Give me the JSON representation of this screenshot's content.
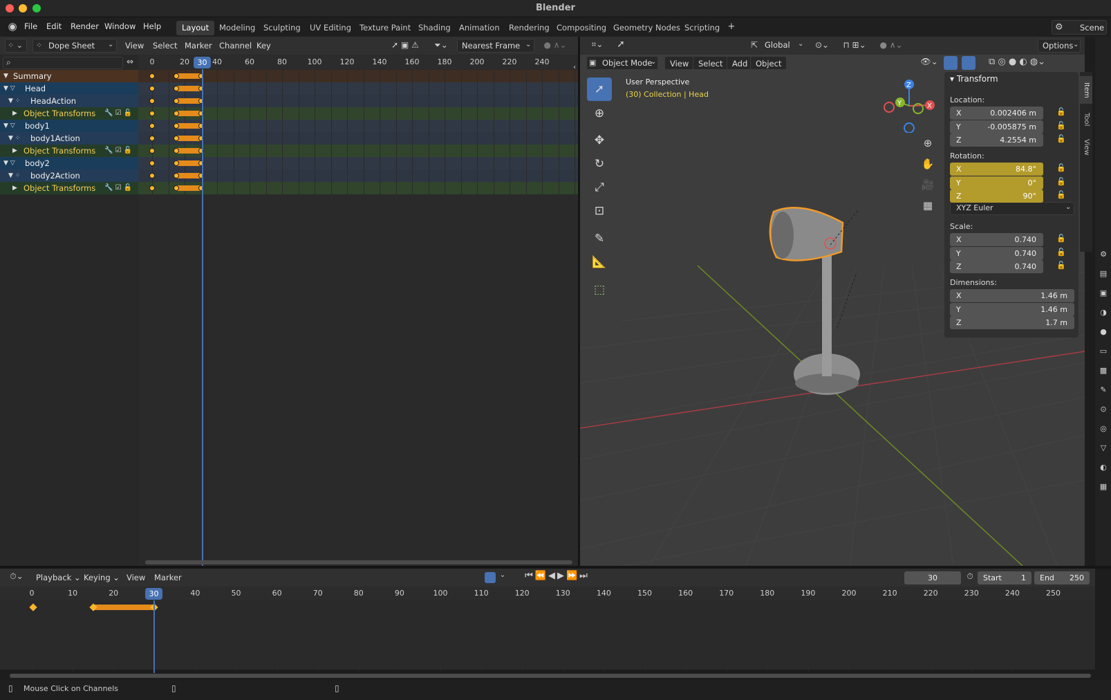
{
  "window": {
    "title": "Blender"
  },
  "menu": [
    "File",
    "Edit",
    "Render",
    "Window",
    "Help"
  ],
  "workspaces": [
    "Layout",
    "Modeling",
    "Sculpting",
    "UV Editing",
    "Texture Paint",
    "Shading",
    "Animation",
    "Rendering",
    "Compositing",
    "Geometry Nodes",
    "Scripting"
  ],
  "active_workspace": "Layout",
  "scene_label": "Scene",
  "dopesheet": {
    "mode": "Dope Sheet",
    "menus": [
      "View",
      "Select",
      "Marker",
      "Channel",
      "Key"
    ],
    "snap": "Nearest Frame",
    "frame_ticks": [
      "0",
      "20",
      "30",
      "40",
      "60",
      "80",
      "100",
      "120",
      "140",
      "160",
      "180",
      "200",
      "220",
      "240"
    ],
    "current_frame": "30",
    "channels": [
      {
        "label": "Summary",
        "kind": "summary"
      },
      {
        "label": "Head",
        "kind": "object"
      },
      {
        "label": "HeadAction",
        "kind": "action"
      },
      {
        "label": "Object Transforms",
        "kind": "group"
      },
      {
        "label": "body1",
        "kind": "object"
      },
      {
        "label": "body1Action",
        "kind": "action"
      },
      {
        "label": "Object Transforms",
        "kind": "group"
      },
      {
        "label": "body2",
        "kind": "object"
      },
      {
        "label": "body2Action",
        "kind": "action"
      },
      {
        "label": "Object Transforms",
        "kind": "group"
      }
    ]
  },
  "viewport": {
    "transform_orientation": "Global",
    "mode": "Object Mode",
    "menus": [
      "View",
      "Select",
      "Add",
      "Object"
    ],
    "options": "Options",
    "overlay_title": "User Perspective",
    "overlay_sub": "(30) Collection | Head"
  },
  "transform_panel": {
    "title": "Transform",
    "location_label": "Location:",
    "location": [
      {
        "axis": "X",
        "value": "0.002406 m"
      },
      {
        "axis": "Y",
        "value": "-0.005875 m"
      },
      {
        "axis": "Z",
        "value": "4.2554 m"
      }
    ],
    "rotation_label": "Rotation:",
    "rotation": [
      {
        "axis": "X",
        "value": "84.8°"
      },
      {
        "axis": "Y",
        "value": "0°"
      },
      {
        "axis": "Z",
        "value": "90°"
      }
    ],
    "rotation_mode": "XYZ Euler",
    "scale_label": "Scale:",
    "scale": [
      {
        "axis": "X",
        "value": "0.740"
      },
      {
        "axis": "Y",
        "value": "0.740"
      },
      {
        "axis": "Z",
        "value": "0.740"
      }
    ],
    "dimensions_label": "Dimensions:",
    "dimensions": [
      {
        "axis": "X",
        "value": "1.46 m"
      },
      {
        "axis": "Y",
        "value": "1.46 m"
      },
      {
        "axis": "Z",
        "value": "1.7 m"
      }
    ],
    "side_tabs": [
      "Item",
      "Tool",
      "View"
    ]
  },
  "timeline": {
    "menus": [
      "Playback",
      "Keying",
      "View",
      "Marker"
    ],
    "current_frame": "30",
    "start_label": "Start",
    "start": "1",
    "end_label": "End",
    "end": "250",
    "ticks": [
      "0",
      "10",
      "20",
      "30",
      "40",
      "50",
      "60",
      "70",
      "80",
      "90",
      "100",
      "110",
      "120",
      "130",
      "140",
      "150",
      "160",
      "170",
      "180",
      "190",
      "200",
      "210",
      "220",
      "230",
      "240",
      "250"
    ]
  },
  "status": {
    "text": "Mouse Click on Channels"
  },
  "colors": {
    "accent_blue": "#4772b3",
    "key_orange": "#ffb52a",
    "bar_orange": "#e48b1b",
    "anim_field": "#b39b2c",
    "x_axis": "#e05050",
    "y_axis": "#8ab62c",
    "z_axis": "#3c82e6"
  }
}
